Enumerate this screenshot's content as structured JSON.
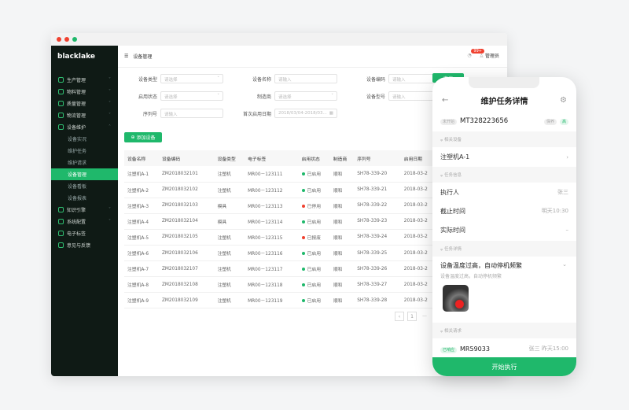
{
  "app": {
    "brand": "blacklake",
    "breadcrumb": "设备管理",
    "notification_count": "99+",
    "user": "管理员",
    "accent": "#1fb86b"
  },
  "sidebar": {
    "items": [
      {
        "label": "生产管理",
        "icon": "production-icon",
        "expandable": true
      },
      {
        "label": "物料管理",
        "icon": "material-icon",
        "expandable": true
      },
      {
        "label": "质量管理",
        "icon": "shield-icon",
        "expandable": true
      },
      {
        "label": "物流管理",
        "icon": "truck-icon",
        "expandable": true
      },
      {
        "label": "设备维护",
        "icon": "wrench-icon",
        "expanded": true,
        "children": [
          "设备实况",
          "维护任务",
          "维护请求",
          "设备管理",
          "设备看板",
          "设备报表"
        ],
        "active_child": "设备管理"
      },
      {
        "label": "知识引擎",
        "icon": "book-icon",
        "expandable": true
      },
      {
        "label": "系统配置",
        "icon": "settings-icon",
        "expandable": true
      },
      {
        "label": "电子标签",
        "icon": "tag-icon"
      },
      {
        "label": "意见与反馈",
        "icon": "mail-icon"
      }
    ]
  },
  "filters": [
    {
      "label": "设备类型",
      "placeholder": "请选择",
      "type": "select"
    },
    {
      "label": "设备名称",
      "placeholder": "请输入",
      "type": "input"
    },
    {
      "label": "设备编码",
      "placeholder": "请输入",
      "type": "input"
    },
    {
      "label": "启用状态",
      "placeholder": "请选择",
      "type": "select"
    },
    {
      "label": "制造商",
      "placeholder": "请选择",
      "type": "select"
    },
    {
      "label": "设备型号",
      "placeholder": "请输入",
      "type": "input"
    },
    {
      "label": "序列号",
      "placeholder": "请输入",
      "type": "input"
    },
    {
      "label": "首次启用日期",
      "placeholder": "2018/03/04-2018/03...",
      "type": "date"
    }
  ],
  "search_label": "查询",
  "add_label": "添加设备",
  "table": {
    "columns": [
      "设备名称",
      "设备编码",
      "设备类型",
      "电子标签",
      "启用状态",
      "制造商",
      "序列号",
      "启用日期"
    ],
    "rows": [
      [
        "注塑机A-1",
        "ZM2018032101",
        "注塑机",
        "MR00－123111",
        "已启用",
        "顺和",
        "SH78-339-20",
        "2018-03-2"
      ],
      [
        "注塑机A-2",
        "ZM2018032102",
        "注塑机",
        "MR00－123112",
        "已启用",
        "顺和",
        "SH78-339-21",
        "2018-03-2"
      ],
      [
        "注塑机A-3",
        "ZM2018032103",
        "模具",
        "MR00－123113",
        "已停用",
        "顺和",
        "SH78-339-22",
        "2018-03-2"
      ],
      [
        "注塑机A-4",
        "ZM2018032104",
        "模具",
        "MR00－123114",
        "已启用",
        "顺和",
        "SH78-339-23",
        "2018-03-2"
      ],
      [
        "注塑机A-5",
        "ZM2018032105",
        "注塑机",
        "MR00－123115",
        "已报废",
        "顺和",
        "SH78-339-24",
        "2018-03-2"
      ],
      [
        "注塑机A-6",
        "ZM2018032106",
        "注塑机",
        "MR00－123116",
        "已启用",
        "顺和",
        "SH78-339-25",
        "2018-03-2"
      ],
      [
        "注塑机A-7",
        "ZM2018032107",
        "注塑机",
        "MR00－123117",
        "已启用",
        "顺和",
        "SH78-339-26",
        "2018-03-2"
      ],
      [
        "注塑机A-8",
        "ZM2018032108",
        "注塑机",
        "MR00－123118",
        "已启用",
        "顺和",
        "SH78-339-27",
        "2018-03-2"
      ],
      [
        "注塑机A-9",
        "ZM2018032109",
        "注塑机",
        "MR00－123119",
        "已启用",
        "顺和",
        "SH78-339-28",
        "2018-03-2"
      ]
    ],
    "status_colors": {
      "已启用": "#1fb86b",
      "已停用": "#f0412f",
      "已报废": "#f0412f"
    }
  },
  "pagination": {
    "current": "1",
    "ellipsis": "···"
  },
  "phone": {
    "title": "维护任务详情",
    "status_tag": "未开始",
    "task_id": "MT328223656",
    "type_tag": "保养",
    "priority_tag": "高",
    "sec_device": "相关设备",
    "device": "注塑机A-1",
    "sec_info": "任务信息",
    "executor_label": "执行人",
    "executor": "张三",
    "deadline_label": "截止时间",
    "deadline": "明天10:30",
    "actual_label": "实际时间",
    "actual": "–",
    "sec_detail": "任务详情",
    "detail_title": "设备温度过高，自动停机频繁",
    "detail_desc": "设备温度过高，自动停机频繁",
    "sec_request": "相关请求",
    "req_tag": "已响应",
    "req_id": "MR59033",
    "req_meta": "张三 昨天15:00",
    "cta": "开始执行"
  }
}
